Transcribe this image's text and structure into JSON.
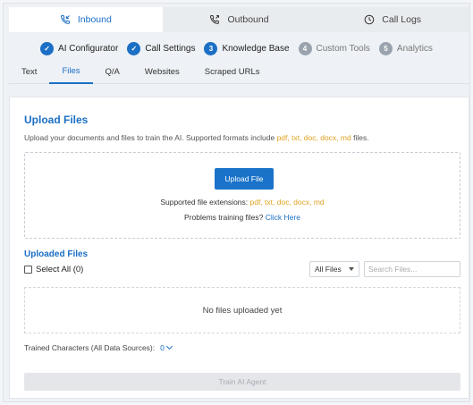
{
  "mode_tabs": [
    {
      "label": "Inbound",
      "icon": "phone-incoming-icon",
      "active": true
    },
    {
      "label": "Outbound",
      "icon": "phone-outgoing-icon",
      "active": false
    },
    {
      "label": "Call Logs",
      "icon": "clock-icon",
      "active": false
    }
  ],
  "steps": [
    {
      "marker": "✓",
      "label": "AI Configurator",
      "state": "done"
    },
    {
      "marker": "✓",
      "label": "Call Settings",
      "state": "done"
    },
    {
      "marker": "3",
      "label": "Knowledge Base",
      "state": "current"
    },
    {
      "marker": "4",
      "label": "Custom Tools",
      "state": "todo"
    },
    {
      "marker": "5",
      "label": "Analytics",
      "state": "todo"
    }
  ],
  "content_tabs": [
    {
      "label": "Text",
      "active": false
    },
    {
      "label": "Files",
      "active": true
    },
    {
      "label": "Q/A",
      "active": false
    },
    {
      "label": "Websites",
      "active": false
    },
    {
      "label": "Scraped URLs",
      "active": false
    }
  ],
  "upload": {
    "title": "Upload Files",
    "subtitle_prefix": "Upload your documents and files to train the AI. Supported formats include ",
    "subtitle_formats": "pdf, txt, doc, docx, md",
    "subtitle_suffix": " files.",
    "button_label": "Upload File",
    "ext_prefix": "Supported file extensions: ",
    "ext_list": "pdf, txt, doc, docx, md",
    "help_prefix": "Problems training files? ",
    "help_link": "Click Here"
  },
  "uploaded": {
    "title": "Uploaded Files",
    "select_all": "Select All (0)",
    "filter_value": "All Files",
    "search_placeholder": "Search Files...",
    "empty_text": "No files uploaded yet"
  },
  "trained": {
    "label": "Trained Characters (All Data Sources):",
    "value": "0"
  },
  "train_button": "Train AI Agent",
  "colors": {
    "accent": "#1b6fc5",
    "highlight": "#e0a21f",
    "disabled": "#e4e6e9"
  }
}
